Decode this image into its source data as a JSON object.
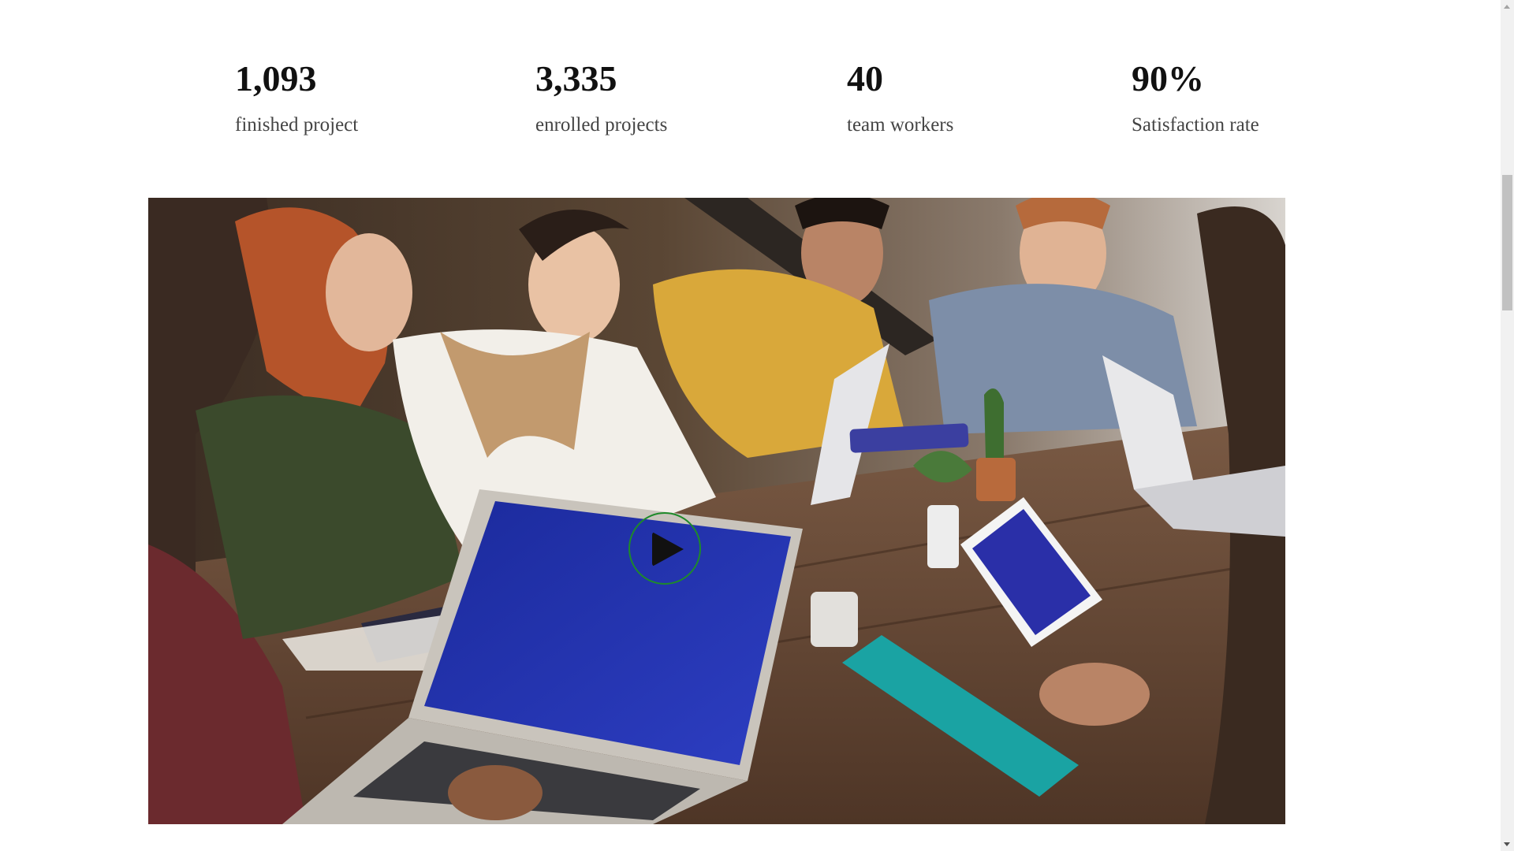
{
  "stats": [
    {
      "number": "1,093",
      "label": "finished project"
    },
    {
      "number": "3,335",
      "label": "enrolled projects"
    },
    {
      "number": "40",
      "label": "team workers"
    },
    {
      "number": "90%",
      "label": "Satisfaction rate"
    }
  ],
  "hero": {
    "image_icon": "team-meeting-photo",
    "play_icon": "play-icon",
    "play_ring_color": "#1e8a2a"
  },
  "colors": {
    "background": "#ffffff",
    "stat_number": "#111111",
    "stat_label": "#444444"
  }
}
